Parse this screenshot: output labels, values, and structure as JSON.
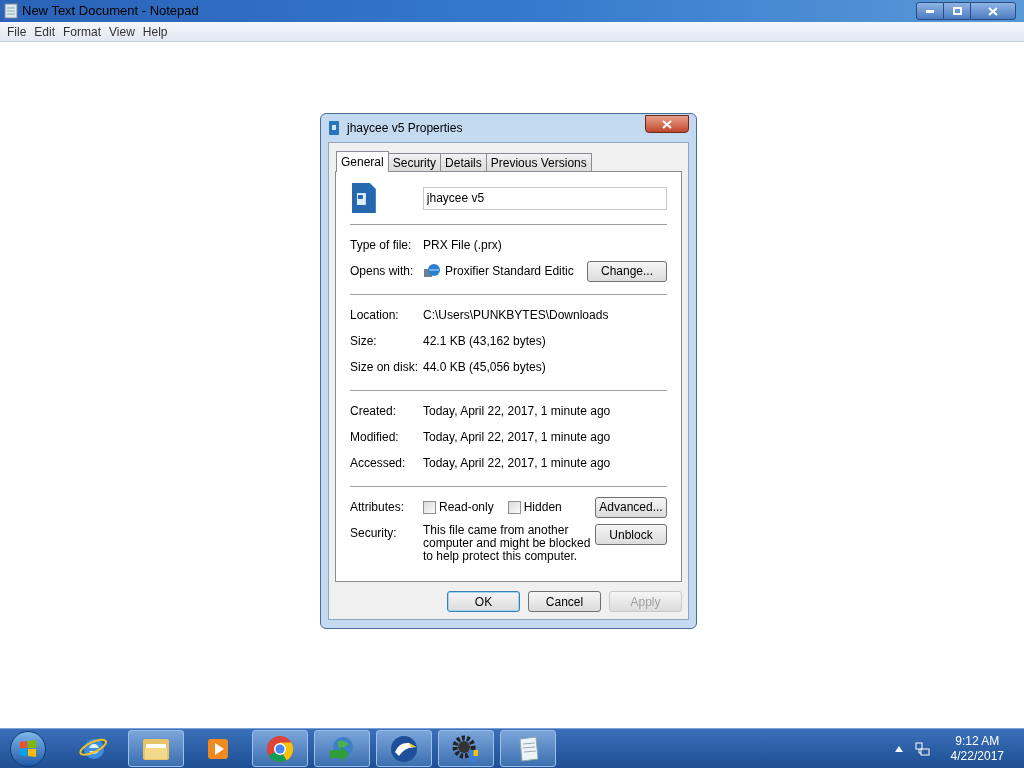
{
  "notepad": {
    "title": "New Text Document - Notepad",
    "menu": [
      "File",
      "Edit",
      "Format",
      "View",
      "Help"
    ]
  },
  "dialog": {
    "title": "jhaycee v5 Properties",
    "tabs": [
      {
        "label": "General",
        "selected": true
      },
      {
        "label": "Security",
        "selected": false
      },
      {
        "label": "Details",
        "selected": false
      },
      {
        "label": "Previous Versions",
        "selected": false
      }
    ],
    "name_value": "jhaycee v5",
    "sections": [
      [
        {
          "kind": "text",
          "label": "Type of file:",
          "value": "PRX File (.prx)"
        },
        {
          "kind": "app",
          "label": "Opens with:",
          "value": "Proxifier Standard Editic",
          "button": "Change..."
        }
      ],
      [
        {
          "kind": "text",
          "label": "Location:",
          "value": "C:\\Users\\PUNKBYTES\\Downloads"
        },
        {
          "kind": "text",
          "label": "Size:",
          "value": "42.1 KB (43,162 bytes)"
        },
        {
          "kind": "text",
          "label": "Size on disk:",
          "value": "44.0 KB (45,056 bytes)"
        }
      ],
      [
        {
          "kind": "text",
          "label": "Created:",
          "value": "Today, April 22, 2017, 1 minute ago"
        },
        {
          "kind": "text",
          "label": "Modified:",
          "value": "Today, April 22, 2017, 1 minute ago"
        },
        {
          "kind": "text",
          "label": "Accessed:",
          "value": "Today, April 22, 2017, 1 minute ago"
        }
      ],
      [
        {
          "kind": "attributes",
          "label": "Attributes:",
          "checkboxes": [
            {
              "label": "Read-only",
              "checked": false
            },
            {
              "label": "Hidden",
              "checked": false
            }
          ],
          "button": "Advanced..."
        },
        {
          "kind": "security",
          "label": "Security:",
          "value": "This file came from another computer and might be blocked to help protect this computer.",
          "button": "Unblock"
        }
      ]
    ],
    "buttons": [
      {
        "label": "OK",
        "default": true,
        "disabled": false
      },
      {
        "label": "Cancel",
        "default": false,
        "disabled": false
      },
      {
        "label": "Apply",
        "default": false,
        "disabled": true
      }
    ]
  },
  "taskbar": {
    "items": [
      {
        "kind": "ie",
        "running": false
      },
      {
        "kind": "explorer",
        "running": true
      },
      {
        "kind": "media",
        "running": false
      },
      {
        "kind": "chrome",
        "running": true
      },
      {
        "kind": "download",
        "running": true
      },
      {
        "kind": "eagle",
        "running": true
      },
      {
        "kind": "gear",
        "running": true
      },
      {
        "kind": "notepad",
        "running": true
      }
    ],
    "time": "9:12 AM",
    "date": "4/22/2017"
  }
}
